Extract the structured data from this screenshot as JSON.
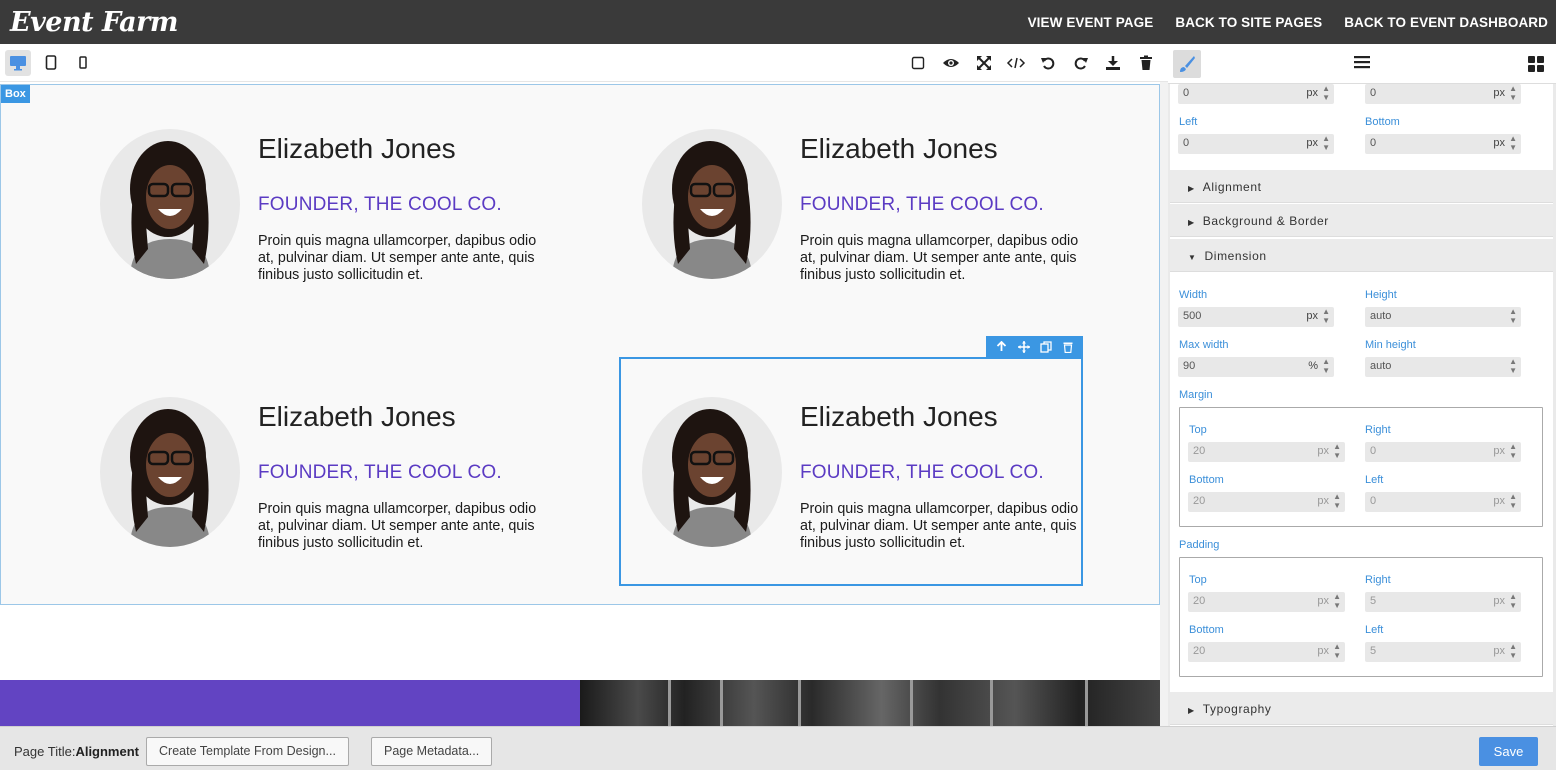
{
  "header": {
    "logo": "Event Farm",
    "nav": [
      "VIEW EVENT PAGE",
      "BACK TO SITE PAGES",
      "BACK TO EVENT DASHBOARD"
    ]
  },
  "toolbar": {
    "devices": [
      "desktop-icon",
      "tablet-icon",
      "mobile-icon"
    ],
    "actions": [
      "square-icon",
      "eye-icon",
      "fullscreen-icon",
      "code-icon",
      "undo-icon",
      "redo-icon",
      "download-icon",
      "trash-icon"
    ]
  },
  "canvas": {
    "box_tag": "Box",
    "people": [
      {
        "name": "Elizabeth Jones",
        "role": "FOUNDER, THE COOL CO.",
        "bio": "Proin quis magna ullamcorper, dapibus odio at, pulvinar diam. Ut semper ante ante, quis finibus justo sollicitudin et."
      },
      {
        "name": "Elizabeth Jones",
        "role": "FOUNDER, THE COOL CO.",
        "bio": "Proin quis magna ullamcorper, dapibus odio at, pulvinar diam. Ut semper ante ante, quis finibus justo sollicitudin et."
      },
      {
        "name": "Elizabeth Jones",
        "role": "FOUNDER, THE COOL CO.",
        "bio": "Proin quis magna ullamcorper, dapibus odio at, pulvinar diam. Ut semper ante ante, quis finibus justo sollicitudin et."
      },
      {
        "name": "Elizabeth Jones",
        "role": "FOUNDER, THE COOL CO.",
        "bio": "Proin quis magna ullamcorper, dapibus odio at, pulvinar diam. Ut semper ante ante, quis finibus justo sollicitudin et."
      }
    ],
    "accent": "#6244c2",
    "selection_color": "#3b97e3"
  },
  "panel": {
    "position": {
      "top": {
        "value": "0",
        "unit": "px"
      },
      "right": {
        "value": "0",
        "unit": "px"
      },
      "left_label": "Left",
      "left": {
        "value": "0",
        "unit": "px"
      },
      "bottom_label": "Bottom",
      "bottom": {
        "value": "0",
        "unit": "px"
      }
    },
    "sections": {
      "alignment": "Alignment",
      "background": "Background & Border",
      "dimension": "Dimension",
      "typography": "Typography"
    },
    "dimension": {
      "width_label": "Width",
      "width": "500",
      "width_unit": "px",
      "height_label": "Height",
      "height": "auto",
      "max_width_label": "Max width",
      "max_width": "90",
      "max_width_unit": "%",
      "min_height_label": "Min height",
      "min_height": "auto"
    },
    "margin": {
      "title": "Margin",
      "top_label": "Top",
      "top": "20",
      "right_label": "Right",
      "right": "0",
      "bottom_label": "Bottom",
      "bottom": "20",
      "left_label": "Left",
      "left": "0",
      "unit": "px"
    },
    "padding": {
      "title": "Padding",
      "top_label": "Top",
      "top": "20",
      "right_label": "Right",
      "right": "5",
      "bottom_label": "Bottom",
      "bottom": "20",
      "left_label": "Left",
      "left": "5",
      "unit": "px"
    }
  },
  "footer": {
    "page_title_label": "Page Title:",
    "page_title": "Alignment",
    "create_template": "Create Template From Design...",
    "metadata": "Page Metadata...",
    "save": "Save"
  }
}
